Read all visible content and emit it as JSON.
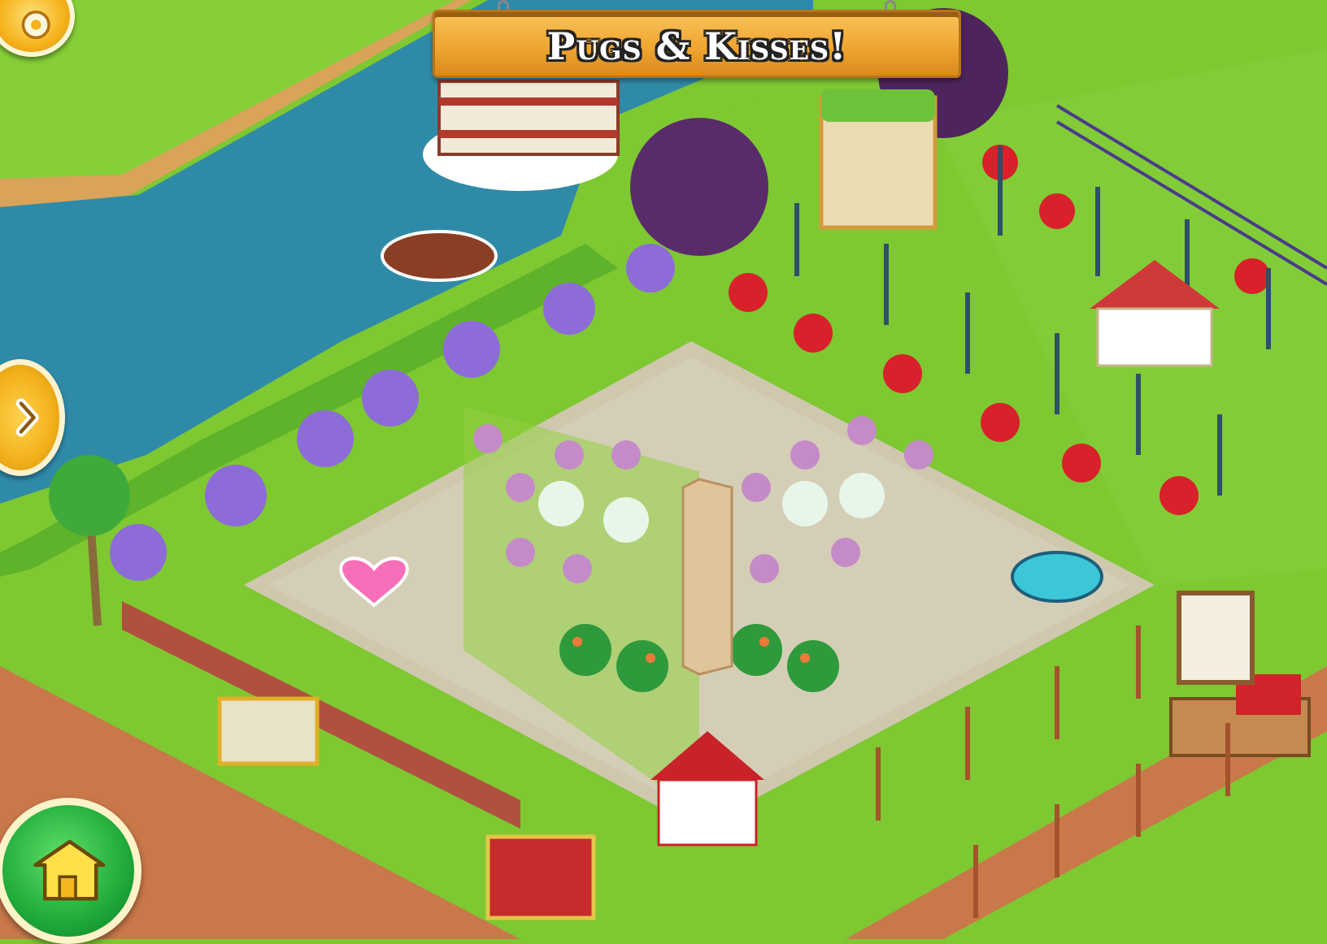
{
  "banner": {
    "title": "Pugs & Kisses!"
  },
  "icons": {
    "settings": "gear-icon",
    "expand": "chevron-right-icon",
    "home": "house-icon"
  },
  "colors": {
    "grass": "#7ec832",
    "river": "#2f8aa8",
    "banner_wood": "#f0a632",
    "home_button": "#1faa3a",
    "accent_yellow": "#f5b21b"
  }
}
